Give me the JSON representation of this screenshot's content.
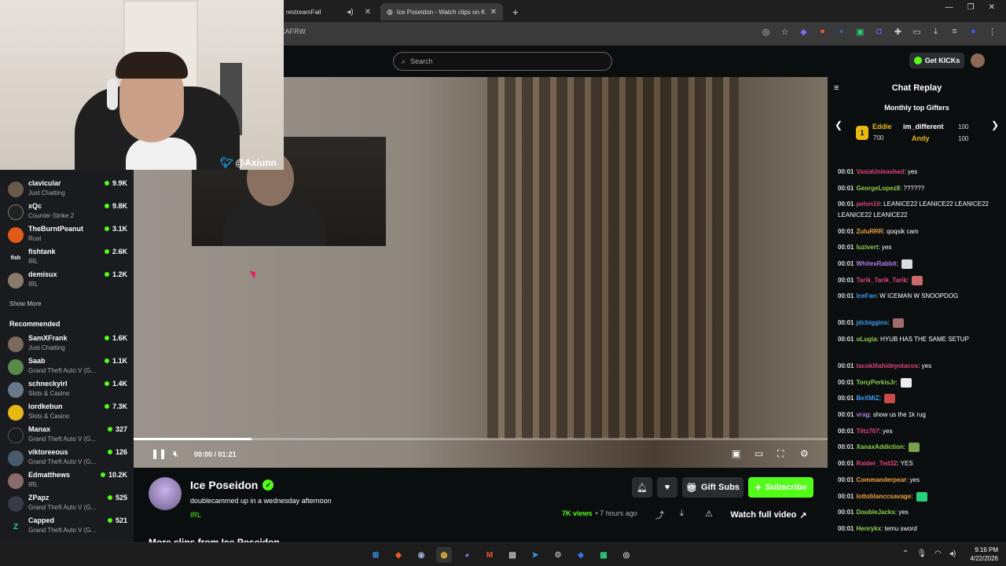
{
  "browser": {
    "tabs": [
      {
        "label": "restreamFail",
        "active": false
      },
      {
        "label": "Ice Poseidon - Watch clips on K",
        "active": true
      }
    ],
    "url": "CAFRW",
    "new_tab": "+"
  },
  "header": {
    "search_placeholder": "Search",
    "get_kicks_label": "Get KICKs"
  },
  "webcam": {
    "twitter_handle": "@Axiunn"
  },
  "sidebar": {
    "following": [
      {
        "name": "clavicular",
        "category": "Just Chatting",
        "viewers": "9.9K"
      },
      {
        "name": "xQc",
        "category": "Counter-Strike 2",
        "viewers": "9.8K"
      },
      {
        "name": "TheBurntPeanut",
        "category": "Rust",
        "viewers": "3.1K"
      },
      {
        "name": "fishtank",
        "category": "IRL",
        "viewers": "2.6K"
      },
      {
        "name": "demisux",
        "category": "IRL",
        "viewers": "1.2K"
      }
    ],
    "show_more": "Show More",
    "recommended_heading": "Recommended",
    "recommended": [
      {
        "name": "SamXFrank",
        "category": "Just Chatting",
        "viewers": "1.6K"
      },
      {
        "name": "Saab",
        "category": "Grand Theft Auto V (G...",
        "viewers": "1.1K"
      },
      {
        "name": "schneckyirl",
        "category": "Slots & Casino",
        "viewers": "1.4K"
      },
      {
        "name": "lordkebun",
        "category": "Slots & Casino",
        "viewers": "7.3K"
      },
      {
        "name": "Manax",
        "category": "Grand Theft Auto V (G...",
        "viewers": "327"
      },
      {
        "name": "viktoreeous",
        "category": "Grand Theft Auto V (G...",
        "viewers": "126"
      },
      {
        "name": "Edmatthews",
        "category": "IRL",
        "viewers": "10.2K"
      },
      {
        "name": "ZPapz",
        "category": "Grand Theft Auto V (G...",
        "viewers": "525"
      },
      {
        "name": "Capped",
        "category": "Grand Theft Auto V (G...",
        "viewers": "521"
      }
    ]
  },
  "player": {
    "time": "00:00 / 01:21",
    "progress": 0.17
  },
  "channel": {
    "name": "Ice Poseidon",
    "title": "doublecammed up in a wednesday afternoon",
    "category": "IRL",
    "gift_subs": "Gift Subs",
    "subscribe": "Subscribe",
    "views": "7K views",
    "posted": "• 7 hours ago",
    "watch_full": "Watch full video",
    "more_clips": "More clips from Ice Poseidon"
  },
  "chat": {
    "title": "Chat Replay",
    "gifters_title": "Monthly top Gifters",
    "gifters": [
      {
        "name": "Eddie",
        "amount": "700",
        "color": "#e8b814"
      },
      {
        "name": "im_different",
        "amount": "100",
        "color": "#ffffff"
      },
      {
        "name": "Andy",
        "amount": "100",
        "color": "#e8b814"
      }
    ],
    "rank_badge": "1",
    "messages": [
      {
        "t": "00:01",
        "user": "VasiaUnleashed",
        "color": "#e0457b",
        "text": ": yes"
      },
      {
        "t": "00:01",
        "user": "GeorgeLopez8",
        "color": "#8ad14a",
        "text": ": ??????"
      },
      {
        "t": "00:01",
        "user": "pelon10",
        "color": "#e0457b",
        "text": ": LEANICE22 LEANICE22 LEANICE22 LEANICE22 LEANICE22"
      },
      {
        "t": "00:01",
        "user": "ZuluRRR",
        "color": "#f2a33a",
        "text": ": qoqsik cam"
      },
      {
        "t": "00:01",
        "user": "luzivert",
        "color": "#8ad14a",
        "text": ": yes"
      },
      {
        "t": "00:01",
        "user": "WhitexRabbit",
        "color": "#b57ee8",
        "text": ":"
      },
      {
        "t": "00:01",
        "user": "Tarik_Tarik_Tarik",
        "color": "#e0457b",
        "text": ":"
      },
      {
        "t": "00:01",
        "user": "IceFan",
        "color": "#3aa0f2",
        "text": ": W ICEMAN    W SNOOPDOG"
      },
      {
        "t": "00:01",
        "user": "jdcbiggins",
        "color": "#3aa0f2",
        "text": ":"
      },
      {
        "t": "00:01",
        "user": "oLugia",
        "color": "#8ad14a",
        "text": ": HYUB HAS THE SAME SETUP"
      },
      {
        "t": "00:01",
        "user": "tacokillahideyotacos",
        "color": "#e0457b",
        "text": ": yes"
      },
      {
        "t": "00:01",
        "user": "TonyPerkisJr",
        "color": "#8ad14a",
        "text": ":"
      },
      {
        "t": "00:01",
        "user": "BeXMiZ",
        "color": "#3aa0f2",
        "text": ":"
      },
      {
        "t": "00:01",
        "user": "vrag",
        "color": "#b57ee8",
        "text": ": show us the 1k rug"
      },
      {
        "t": "00:01",
        "user": "Tiltz707",
        "color": "#e0457b",
        "text": ": yes"
      },
      {
        "t": "00:01",
        "user": "XanaxAddiction",
        "color": "#8ad14a",
        "text": ":"
      },
      {
        "t": "00:01",
        "user": "Raider_Ted32",
        "color": "#e0457b",
        "text": ": YES"
      },
      {
        "t": "00:01",
        "user": "Commanderpear",
        "color": "#f2a33a",
        "text": ": yes"
      },
      {
        "t": "00:01",
        "user": "lottoblanccsavage",
        "color": "#f2a33a",
        "text": ":"
      },
      {
        "t": "00:01",
        "user": "DoubleJacks",
        "color": "#8ad14a",
        "text": ": yes"
      },
      {
        "t": "00:01",
        "user": "Henrykx",
        "color": "#8ad14a",
        "text": ": temu sword"
      }
    ]
  },
  "taskbar": {
    "time": "9:16 PM",
    "date": "4/22/2026"
  },
  "colors": {
    "accent": "#53fc18",
    "background": "#0b0e0f",
    "sidebar": "#191b1f"
  }
}
